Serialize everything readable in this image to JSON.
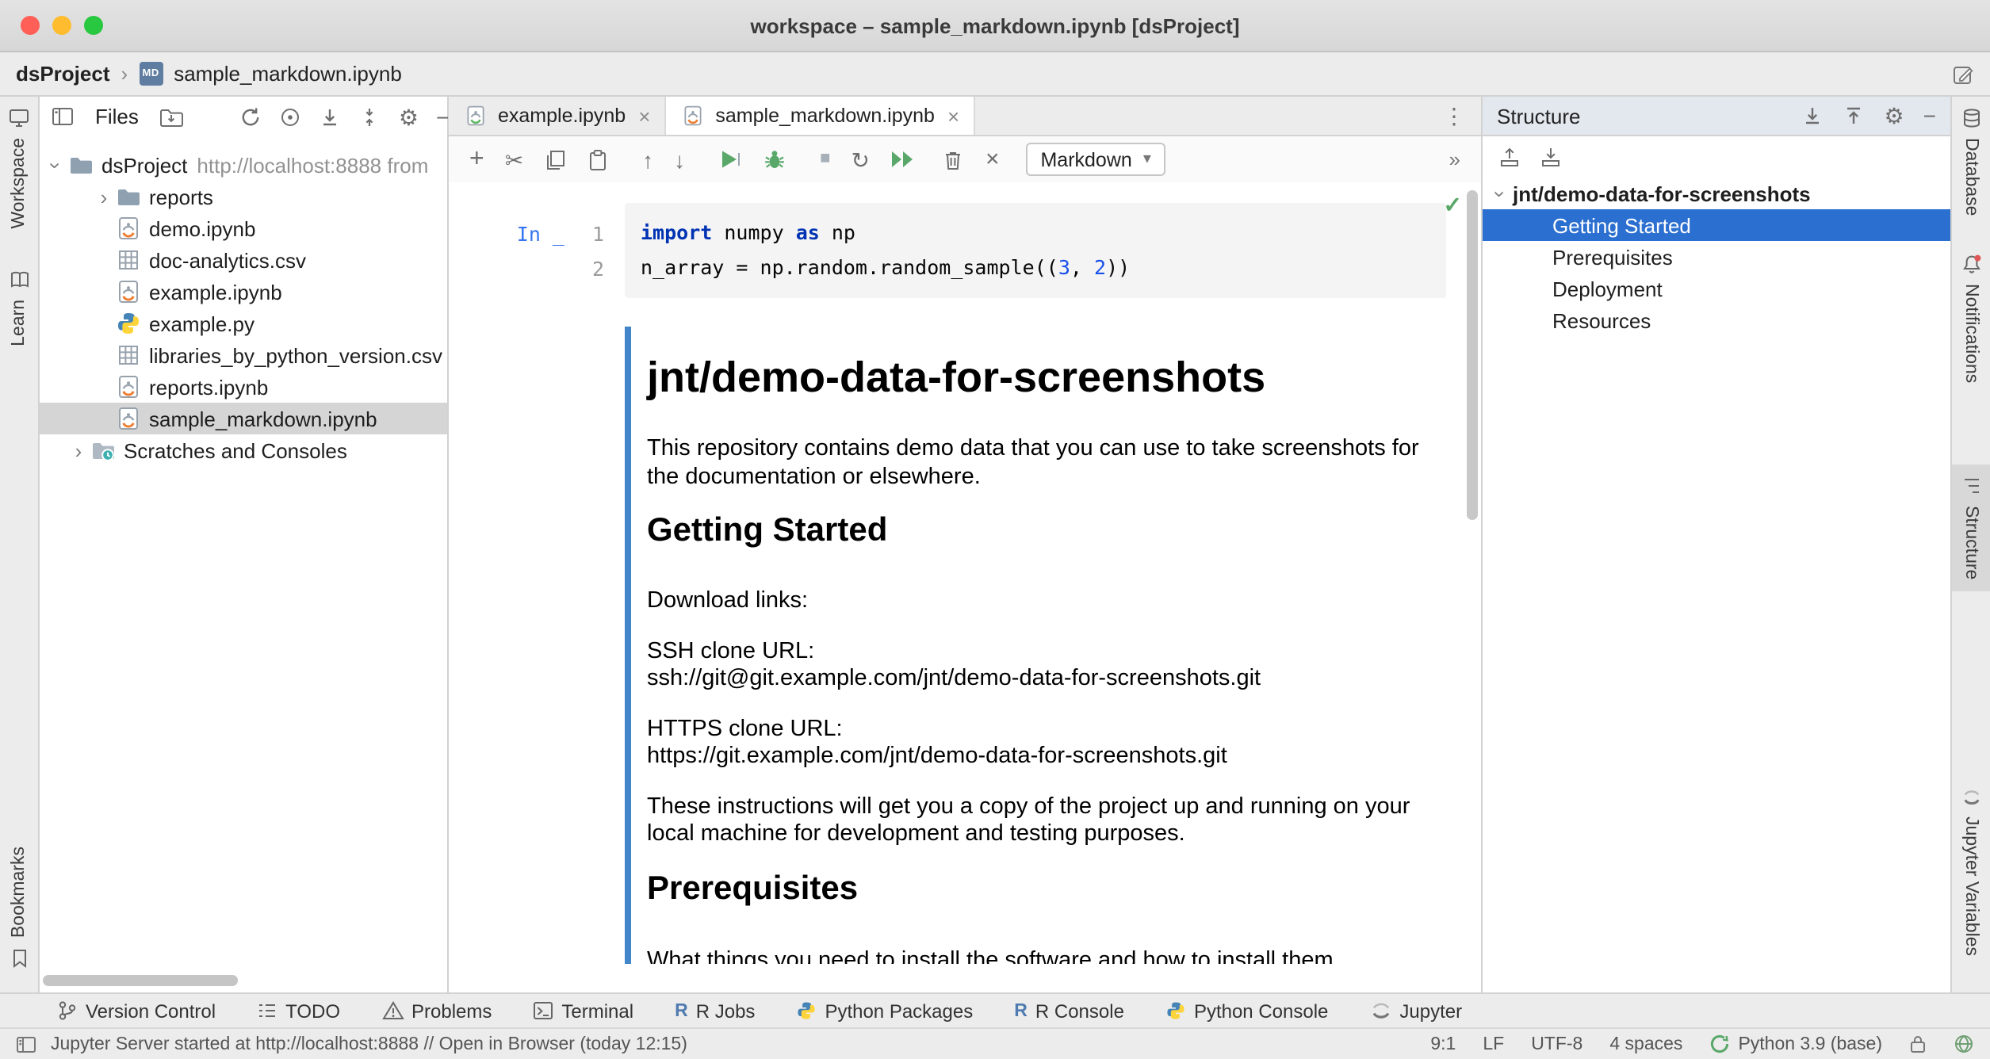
{
  "window": {
    "title": "workspace – sample_markdown.ipynb [dsProject]"
  },
  "icons": {
    "plus": "+",
    "cut": "✂",
    "arrow_up": "↑",
    "arrow_down": "↓",
    "close": "×",
    "kebab": "⋮",
    "more": "»",
    "gear": "⚙",
    "minus": "−",
    "check": "✓",
    "chevron": "›",
    "dropdown": "▾",
    "crumb_sep": "›",
    "restart": "↻",
    "stop": "■",
    "md_badge": "MD"
  },
  "breadcrumbs": {
    "project": "dsProject",
    "file": "sample_markdown.ipynb"
  },
  "stripes": {
    "left": [
      "Workspace",
      "Learn",
      "Bookmarks"
    ],
    "right": [
      "Database",
      "Notifications",
      "Structure",
      "Jupyter Variables"
    ]
  },
  "files": {
    "title": "Files",
    "tree": [
      {
        "label": "dsProject",
        "hint": "http://localhost:8888 from"
      },
      {
        "label": "reports"
      },
      {
        "label": "demo.ipynb"
      },
      {
        "label": "doc-analytics.csv"
      },
      {
        "label": "example.ipynb"
      },
      {
        "label": "example.py"
      },
      {
        "label": "libraries_by_python_version.csv"
      },
      {
        "label": "reports.ipynb"
      },
      {
        "label": "sample_markdown.ipynb"
      },
      {
        "label": "Scratches and Consoles"
      }
    ]
  },
  "editor": {
    "tabs": [
      {
        "label": "example.ipynb"
      },
      {
        "label": "sample_markdown.ipynb"
      }
    ],
    "toolbar": {
      "cell_type": "Markdown"
    },
    "code": {
      "prompt": "In _",
      "num1": "1",
      "num2": "2",
      "l1": {
        "kw1": "import",
        "t1": " numpy ",
        "kw2": "as",
        "t2": " np"
      },
      "l2": {
        "t1": "n_array = np.random.random_sample((",
        "n1": "3",
        "t2": ", ",
        "n2": "2",
        "t3": "))"
      }
    },
    "markdown": {
      "h1": "jnt/demo-data-for-screenshots",
      "p1": "This repository contains demo data that you can use to take screenshots for the documentation or elsewhere.",
      "h2a": "Getting Started",
      "p2": "Download links:",
      "p3a": "SSH clone URL:",
      "p3b": "ssh://git@git.example.com/jnt/demo-data-for-screenshots.git",
      "p4a": "HTTPS clone URL:",
      "p4b": "https://git.example.com/jnt/demo-data-for-screenshots.git",
      "p5": "These instructions will get you a copy of the project up and running on your local machine for development and testing purposes.",
      "h2b": "Prerequisites",
      "p6": "What things you need to install the software and how to install them"
    }
  },
  "structure": {
    "title": "Structure",
    "tree": [
      {
        "label": "jnt/demo-data-for-screenshots"
      },
      {
        "label": "Getting Started"
      },
      {
        "label": "Prerequisites"
      },
      {
        "label": "Deployment"
      },
      {
        "label": "Resources"
      }
    ]
  },
  "bottom": {
    "items": [
      "Version Control",
      "TODO",
      "Problems",
      "Terminal",
      "R Jobs",
      "Python Packages",
      "R Console",
      "Python Console",
      "Jupyter"
    ]
  },
  "status": {
    "message": "Jupyter Server started at http://localhost:8888 // Open in Browser (today 12:15)",
    "caret": "9:1",
    "line_sep": "LF",
    "encoding": "UTF-8",
    "indent": "4 spaces",
    "interpreter": "Python 3.9 (base)"
  }
}
